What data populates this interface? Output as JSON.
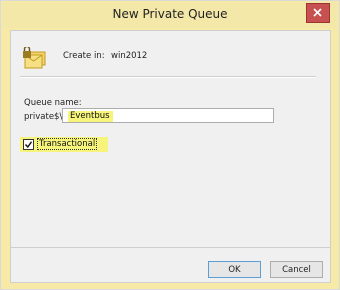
{
  "window": {
    "title": "New Private Queue"
  },
  "header": {
    "create_in_label": "Create in:",
    "create_in_value": "win2012",
    "icon": "private-queue-icon"
  },
  "form": {
    "queue_name_label": "Queue name:",
    "prefix": "private$\\",
    "queue_name_value": "Eventbus",
    "transactional_label": "Transactional",
    "transactional_checked": true
  },
  "buttons": {
    "ok_label": "OK",
    "cancel_label": "Cancel"
  },
  "colors": {
    "highlight": "#f6f47a",
    "title_bar": "#f4e8a8",
    "close_button": "#c75050"
  }
}
